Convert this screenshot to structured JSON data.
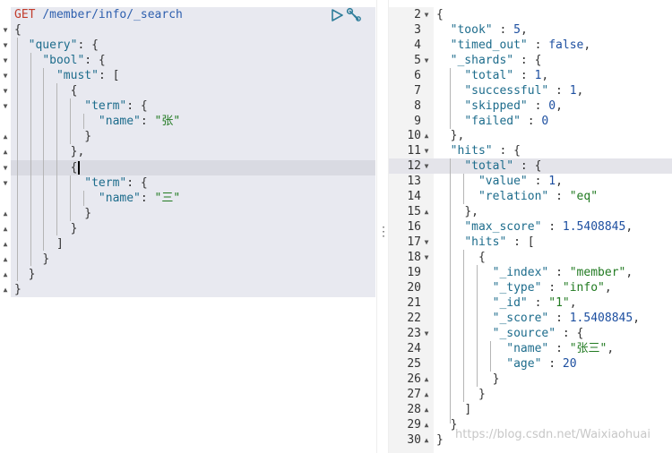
{
  "request": {
    "method": "GET",
    "path": "/member/info/_search",
    "body": {
      "query_key": "\"query\"",
      "bool_key": "\"bool\"",
      "must_key": "\"must\"",
      "term_key": "\"term\"",
      "name_key": "\"name\"",
      "term1_value": "\"张\"",
      "term2_value": "\"三\""
    }
  },
  "actions": {
    "run_icon": "play-icon",
    "settings_icon": "wrench-icon"
  },
  "response": {
    "line_numbers": [
      "2",
      "3",
      "4",
      "5",
      "6",
      "7",
      "8",
      "9",
      "10",
      "11",
      "12",
      "13",
      "14",
      "15",
      "16",
      "17",
      "18",
      "19",
      "20",
      "21",
      "22",
      "23",
      "24",
      "25",
      "26",
      "27",
      "28",
      "29",
      "30"
    ],
    "took_key": "\"took\"",
    "took": "5",
    "timed_out_key": "\"timed_out\"",
    "timed_out": "false",
    "shards_key": "\"_shards\"",
    "total_key": "\"total\"",
    "shards_total": "1",
    "successful_key": "\"successful\"",
    "successful": "1",
    "skipped_key": "\"skipped\"",
    "skipped": "0",
    "failed_key": "\"failed\"",
    "failed": "0",
    "hits_key": "\"hits\"",
    "value_key": "\"value\"",
    "hits_total_value": "1",
    "relation_key": "\"relation\"",
    "relation": "\"eq\"",
    "max_score_key": "\"max_score\"",
    "max_score": "1.5408845",
    "index_key": "\"_index\"",
    "index": "\"member\"",
    "type_key": "\"_type\"",
    "type": "\"info\"",
    "id_key": "\"_id\"",
    "id": "\"1\"",
    "score_key": "\"_score\"",
    "score": "1.5408845",
    "source_key": "\"_source\"",
    "name_key": "\"name\"",
    "name": "\"张三\"",
    "age_key": "\"age\"",
    "age": "20"
  },
  "watermark": "https://blog.csdn.net/Waixiaohuai"
}
